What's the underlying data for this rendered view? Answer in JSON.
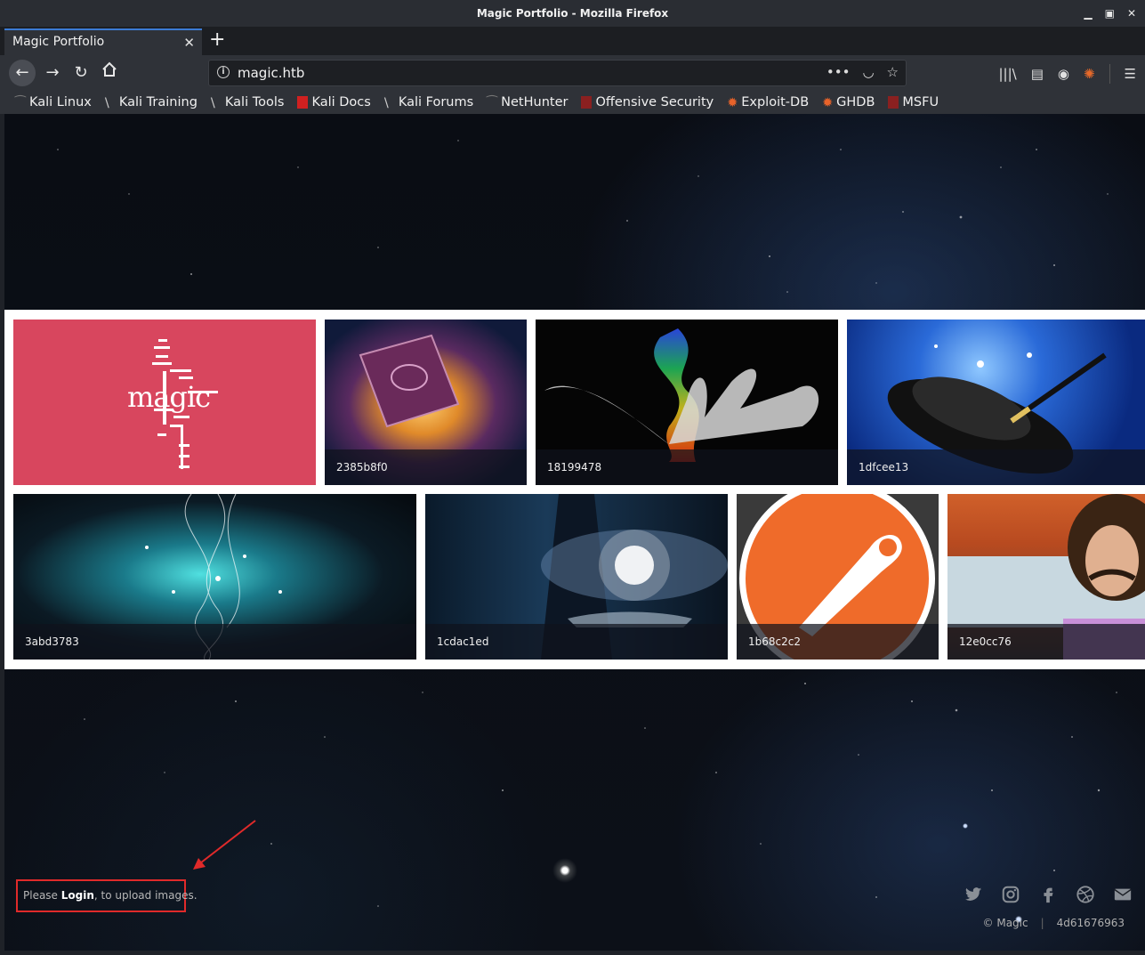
{
  "window": {
    "title": "Magic Portfolio - Mozilla Firefox"
  },
  "tab": {
    "title": "Magic Portfolio"
  },
  "url": "magic.htb",
  "bookmarks": [
    "Kali Linux",
    "Kali Training",
    "Kali Tools",
    "Kali Docs",
    "Kali Forums",
    "NetHunter",
    "Offensive Security",
    "Exploit-DB",
    "GHDB",
    "MSFU"
  ],
  "gallery": {
    "images": [
      {
        "caption": "",
        "logo": "magic"
      },
      {
        "caption": "2385b8f0"
      },
      {
        "caption": "18199478"
      },
      {
        "caption": "1dfcee13"
      },
      {
        "caption": "3abd3783"
      },
      {
        "caption": "1cdac1ed"
      },
      {
        "caption": "1b68c2c2"
      },
      {
        "caption": "12e0cc76"
      }
    ]
  },
  "footer": {
    "login_prefix": "Please ",
    "login_link": "Login",
    "login_suffix": ", to upload images.",
    "copyright": "© Magic",
    "hash": "4d61676963"
  },
  "social_icons": [
    "twitter-icon",
    "instagram-icon",
    "facebook-icon",
    "dribbble-icon",
    "envelope-icon"
  ],
  "colors": {
    "annotation_red": "#e02a2a",
    "tab_accent": "#3b7ad3"
  }
}
